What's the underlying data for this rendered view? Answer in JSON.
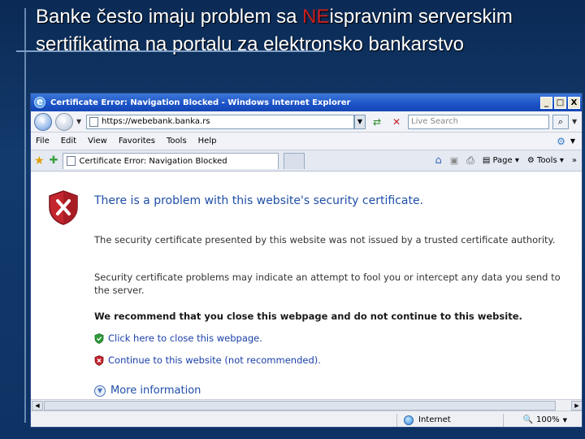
{
  "slide": {
    "title_part1": "Banke često imaju problem sa ",
    "title_highlight": "NE",
    "title_part2": "ispravnim serverskim sertifikatima na portalu za elektronsko bankarstvo"
  },
  "browser": {
    "window_title": "Certificate Error: Navigation Blocked - Windows Internet Explorer",
    "controls": {
      "minimize": "_",
      "maximize": "□",
      "close": "X"
    },
    "address": "https://webebank.banka.rs",
    "search_placeholder": "Live Search",
    "menu": [
      "File",
      "Edit",
      "View",
      "Favorites",
      "Tools",
      "Help"
    ],
    "tab_title": "Certificate Error: Navigation Blocked",
    "command_bar": {
      "page_label": "Page",
      "tools_label": "Tools",
      "overflow": "»"
    }
  },
  "content": {
    "heading": "There is a problem with this website's security certificate.",
    "para1": "The security certificate presented by this website was not issued by a trusted certificate authority.",
    "para2": "Security certificate problems may indicate an attempt to fool you or intercept any data you send to the server.",
    "recommend": "We recommend that you close this webpage and do not continue to this website.",
    "link_close": "Click here to close this webpage.",
    "link_continue": "Continue to this website (not recommended).",
    "more_info": "More information"
  },
  "status": {
    "zone": "Internet",
    "zoom": "100%"
  },
  "colors": {
    "accent_blue": "#1f4fa8",
    "highlight_red": "#cc2020",
    "slide_bg": "#0e3263"
  }
}
